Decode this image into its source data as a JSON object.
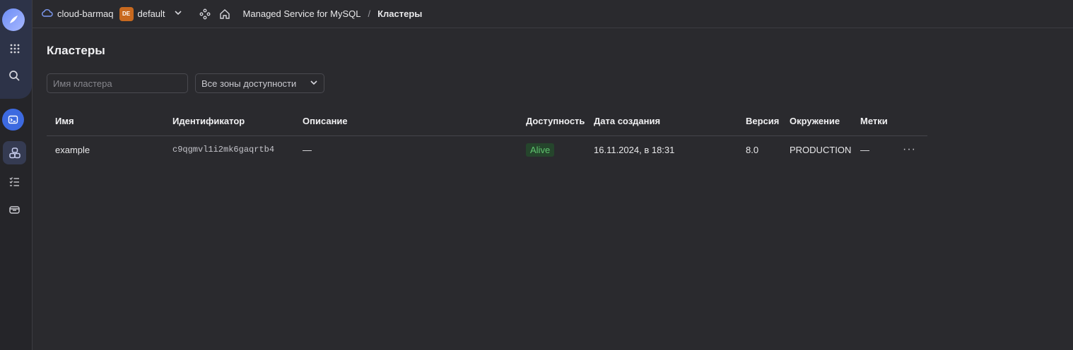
{
  "header": {
    "cloud_name": "cloud-barmaq",
    "folder_badge": "DE",
    "folder_name": "default",
    "breadcrumb_service": "Managed Service for MySQL",
    "breadcrumb_separator": "/",
    "breadcrumb_current": "Кластеры"
  },
  "page": {
    "title": "Кластеры",
    "search_placeholder": "Имя кластера",
    "zone_filter": "Все зоны доступности"
  },
  "table": {
    "columns": [
      "Имя",
      "Идентификатор",
      "Описание",
      "Доступность",
      "Дата создания",
      "Версия",
      "Окружение",
      "Метки"
    ],
    "rows": [
      {
        "name": "example",
        "id": "c9qgmvl1i2mk6gaqrtb4",
        "description": "—",
        "availability": "Alive",
        "created": "16.11.2024, в 18:31",
        "version": "8.0",
        "environment": "PRODUCTION",
        "labels": "—",
        "actions": "···"
      }
    ]
  },
  "colors": {
    "background": "#2a2a2e",
    "alive_text": "#5fc46e",
    "badge_orange": "#c8691f"
  },
  "icons": {
    "rail": [
      "logo-icon",
      "apps-grid-icon",
      "search-icon",
      "service-icon",
      "clusters-icon",
      "operations-list-icon",
      "storage-icon"
    ],
    "header": [
      "cloud-icon",
      "chevron-down-icon",
      "nodes-icon",
      "home-icon"
    ]
  }
}
